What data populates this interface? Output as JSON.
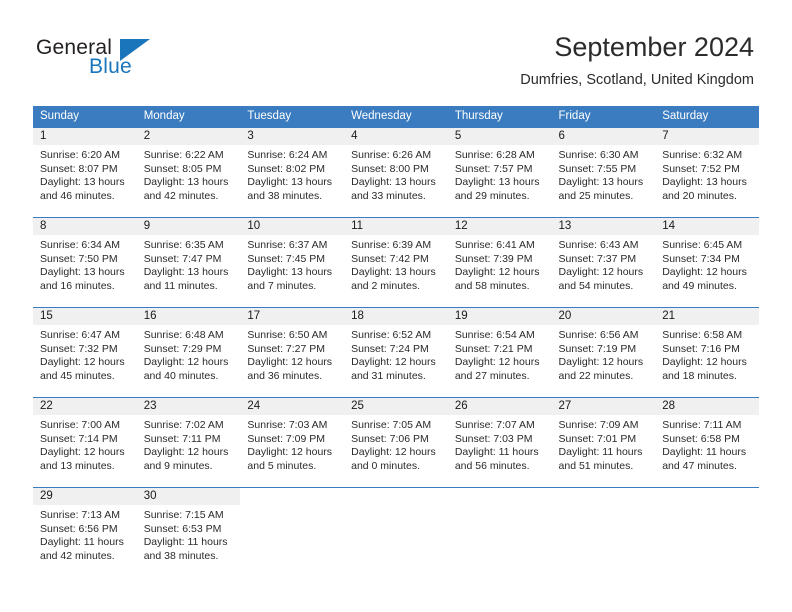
{
  "brand": {
    "name_part1": "General",
    "name_part2": "Blue",
    "triangle_color": "#1b75bb"
  },
  "header": {
    "title": "September 2024",
    "subtitle": "Dumfries, Scotland, United Kingdom"
  },
  "theme": {
    "header_blue": "#3b7cc0",
    "daynum_band": "#f0f0f0",
    "text": "#2a2a2a"
  },
  "weekdays": [
    "Sunday",
    "Monday",
    "Tuesday",
    "Wednesday",
    "Thursday",
    "Friday",
    "Saturday"
  ],
  "weeks": [
    [
      {
        "day": "1",
        "sunrise": "Sunrise: 6:20 AM",
        "sunset": "Sunset: 8:07 PM",
        "daylight_line1": "Daylight: 13 hours",
        "daylight_line2": "and 46 minutes."
      },
      {
        "day": "2",
        "sunrise": "Sunrise: 6:22 AM",
        "sunset": "Sunset: 8:05 PM",
        "daylight_line1": "Daylight: 13 hours",
        "daylight_line2": "and 42 minutes."
      },
      {
        "day": "3",
        "sunrise": "Sunrise: 6:24 AM",
        "sunset": "Sunset: 8:02 PM",
        "daylight_line1": "Daylight: 13 hours",
        "daylight_line2": "and 38 minutes."
      },
      {
        "day": "4",
        "sunrise": "Sunrise: 6:26 AM",
        "sunset": "Sunset: 8:00 PM",
        "daylight_line1": "Daylight: 13 hours",
        "daylight_line2": "and 33 minutes."
      },
      {
        "day": "5",
        "sunrise": "Sunrise: 6:28 AM",
        "sunset": "Sunset: 7:57 PM",
        "daylight_line1": "Daylight: 13 hours",
        "daylight_line2": "and 29 minutes."
      },
      {
        "day": "6",
        "sunrise": "Sunrise: 6:30 AM",
        "sunset": "Sunset: 7:55 PM",
        "daylight_line1": "Daylight: 13 hours",
        "daylight_line2": "and 25 minutes."
      },
      {
        "day": "7",
        "sunrise": "Sunrise: 6:32 AM",
        "sunset": "Sunset: 7:52 PM",
        "daylight_line1": "Daylight: 13 hours",
        "daylight_line2": "and 20 minutes."
      }
    ],
    [
      {
        "day": "8",
        "sunrise": "Sunrise: 6:34 AM",
        "sunset": "Sunset: 7:50 PM",
        "daylight_line1": "Daylight: 13 hours",
        "daylight_line2": "and 16 minutes."
      },
      {
        "day": "9",
        "sunrise": "Sunrise: 6:35 AM",
        "sunset": "Sunset: 7:47 PM",
        "daylight_line1": "Daylight: 13 hours",
        "daylight_line2": "and 11 minutes."
      },
      {
        "day": "10",
        "sunrise": "Sunrise: 6:37 AM",
        "sunset": "Sunset: 7:45 PM",
        "daylight_line1": "Daylight: 13 hours",
        "daylight_line2": "and 7 minutes."
      },
      {
        "day": "11",
        "sunrise": "Sunrise: 6:39 AM",
        "sunset": "Sunset: 7:42 PM",
        "daylight_line1": "Daylight: 13 hours",
        "daylight_line2": "and 2 minutes."
      },
      {
        "day": "12",
        "sunrise": "Sunrise: 6:41 AM",
        "sunset": "Sunset: 7:39 PM",
        "daylight_line1": "Daylight: 12 hours",
        "daylight_line2": "and 58 minutes."
      },
      {
        "day": "13",
        "sunrise": "Sunrise: 6:43 AM",
        "sunset": "Sunset: 7:37 PM",
        "daylight_line1": "Daylight: 12 hours",
        "daylight_line2": "and 54 minutes."
      },
      {
        "day": "14",
        "sunrise": "Sunrise: 6:45 AM",
        "sunset": "Sunset: 7:34 PM",
        "daylight_line1": "Daylight: 12 hours",
        "daylight_line2": "and 49 minutes."
      }
    ],
    [
      {
        "day": "15",
        "sunrise": "Sunrise: 6:47 AM",
        "sunset": "Sunset: 7:32 PM",
        "daylight_line1": "Daylight: 12 hours",
        "daylight_line2": "and 45 minutes."
      },
      {
        "day": "16",
        "sunrise": "Sunrise: 6:48 AM",
        "sunset": "Sunset: 7:29 PM",
        "daylight_line1": "Daylight: 12 hours",
        "daylight_line2": "and 40 minutes."
      },
      {
        "day": "17",
        "sunrise": "Sunrise: 6:50 AM",
        "sunset": "Sunset: 7:27 PM",
        "daylight_line1": "Daylight: 12 hours",
        "daylight_line2": "and 36 minutes."
      },
      {
        "day": "18",
        "sunrise": "Sunrise: 6:52 AM",
        "sunset": "Sunset: 7:24 PM",
        "daylight_line1": "Daylight: 12 hours",
        "daylight_line2": "and 31 minutes."
      },
      {
        "day": "19",
        "sunrise": "Sunrise: 6:54 AM",
        "sunset": "Sunset: 7:21 PM",
        "daylight_line1": "Daylight: 12 hours",
        "daylight_line2": "and 27 minutes."
      },
      {
        "day": "20",
        "sunrise": "Sunrise: 6:56 AM",
        "sunset": "Sunset: 7:19 PM",
        "daylight_line1": "Daylight: 12 hours",
        "daylight_line2": "and 22 minutes."
      },
      {
        "day": "21",
        "sunrise": "Sunrise: 6:58 AM",
        "sunset": "Sunset: 7:16 PM",
        "daylight_line1": "Daylight: 12 hours",
        "daylight_line2": "and 18 minutes."
      }
    ],
    [
      {
        "day": "22",
        "sunrise": "Sunrise: 7:00 AM",
        "sunset": "Sunset: 7:14 PM",
        "daylight_line1": "Daylight: 12 hours",
        "daylight_line2": "and 13 minutes."
      },
      {
        "day": "23",
        "sunrise": "Sunrise: 7:02 AM",
        "sunset": "Sunset: 7:11 PM",
        "daylight_line1": "Daylight: 12 hours",
        "daylight_line2": "and 9 minutes."
      },
      {
        "day": "24",
        "sunrise": "Sunrise: 7:03 AM",
        "sunset": "Sunset: 7:09 PM",
        "daylight_line1": "Daylight: 12 hours",
        "daylight_line2": "and 5 minutes."
      },
      {
        "day": "25",
        "sunrise": "Sunrise: 7:05 AM",
        "sunset": "Sunset: 7:06 PM",
        "daylight_line1": "Daylight: 12 hours",
        "daylight_line2": "and 0 minutes."
      },
      {
        "day": "26",
        "sunrise": "Sunrise: 7:07 AM",
        "sunset": "Sunset: 7:03 PM",
        "daylight_line1": "Daylight: 11 hours",
        "daylight_line2": "and 56 minutes."
      },
      {
        "day": "27",
        "sunrise": "Sunrise: 7:09 AM",
        "sunset": "Sunset: 7:01 PM",
        "daylight_line1": "Daylight: 11 hours",
        "daylight_line2": "and 51 minutes."
      },
      {
        "day": "28",
        "sunrise": "Sunrise: 7:11 AM",
        "sunset": "Sunset: 6:58 PM",
        "daylight_line1": "Daylight: 11 hours",
        "daylight_line2": "and 47 minutes."
      }
    ],
    [
      {
        "day": "29",
        "sunrise": "Sunrise: 7:13 AM",
        "sunset": "Sunset: 6:56 PM",
        "daylight_line1": "Daylight: 11 hours",
        "daylight_line2": "and 42 minutes."
      },
      {
        "day": "30",
        "sunrise": "Sunrise: 7:15 AM",
        "sunset": "Sunset: 6:53 PM",
        "daylight_line1": "Daylight: 11 hours",
        "daylight_line2": "and 38 minutes."
      },
      null,
      null,
      null,
      null,
      null
    ]
  ]
}
